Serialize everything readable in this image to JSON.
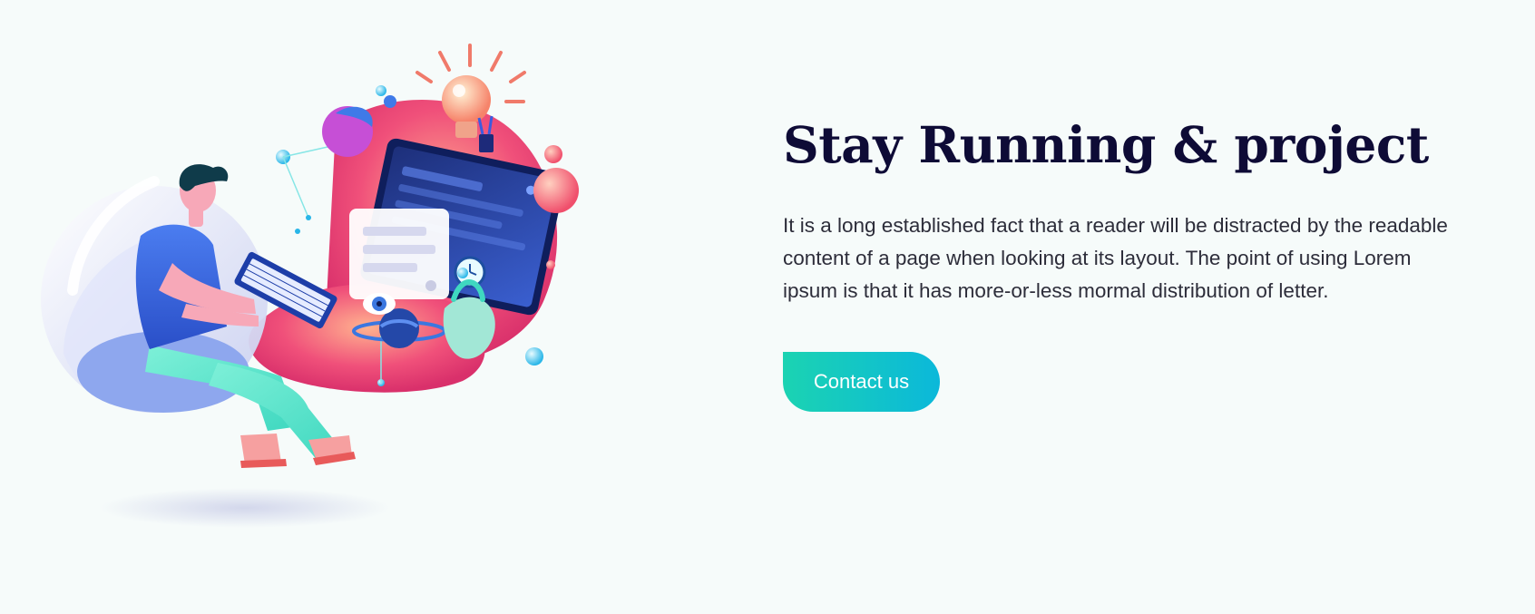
{
  "hero": {
    "title": "Stay Running & project",
    "description": "It is a long established fact that a reader will be distracted by the readable content of a page when looking at its layout. The point of using Lorem ipsum is that it has more-or-less mormal distribution of letter.",
    "cta_label": "Contact us",
    "illustration_icon": "developer-workspace-illustration"
  },
  "colors": {
    "background": "#f6fbfa",
    "title": "#0e0b36",
    "body_text": "#2d2d3a",
    "button_gradient_start": "#1bd3b2",
    "button_gradient_end": "#0bb8da",
    "accent_pink": "#f0507a",
    "accent_blue": "#2b4aa8"
  }
}
